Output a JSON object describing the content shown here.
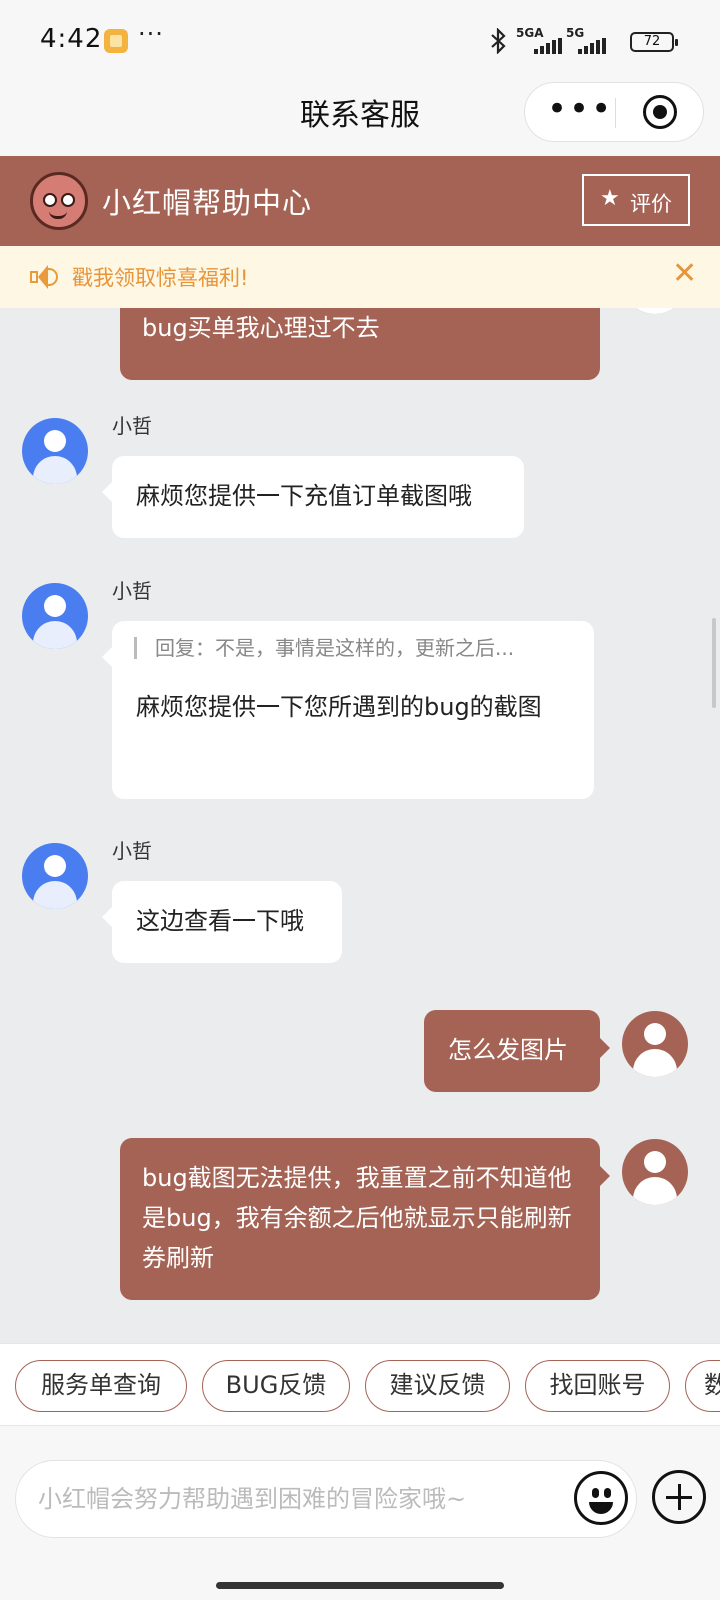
{
  "status_bar": {
    "time": "4:42",
    "more": "···",
    "network1": "5GA",
    "network2": "5G",
    "battery": "72"
  },
  "nav": {
    "title": "联系客服",
    "more_icon": "more-dots-icon",
    "target_icon": "record-icon"
  },
  "help_center": {
    "title": "小红帽帮助中心",
    "rate_label": "评价",
    "colors": {
      "brand": "#a56355"
    }
  },
  "notice": {
    "text": "戳我领取惊喜福利!",
    "color": "#e8953a"
  },
  "messages": [
    {
      "from": "user",
      "text": "bug买单我心理过不去"
    },
    {
      "from": "agent",
      "sender": "小哲",
      "text": "麻烦您提供一下充值订单截图哦"
    },
    {
      "from": "agent",
      "sender": "小哲",
      "quote": "回复：不是，事情是这样的，更新之后...",
      "text": "麻烦您提供一下您所遇到的bug的截图"
    },
    {
      "from": "agent",
      "sender": "小哲",
      "text": "这边查看一下哦"
    },
    {
      "from": "user",
      "text": "怎么发图片"
    },
    {
      "from": "user",
      "text": "bug截图无法提供，我重置之前不知道他是bug，我有余额之后他就显示只能刷新券刷新"
    }
  ],
  "quick_replies": [
    "服务单查询",
    "BUG反馈",
    "建议反馈",
    "找回账号",
    "数"
  ],
  "input": {
    "placeholder": "小红帽会努力帮助遇到困难的冒险家哦~",
    "value": ""
  }
}
